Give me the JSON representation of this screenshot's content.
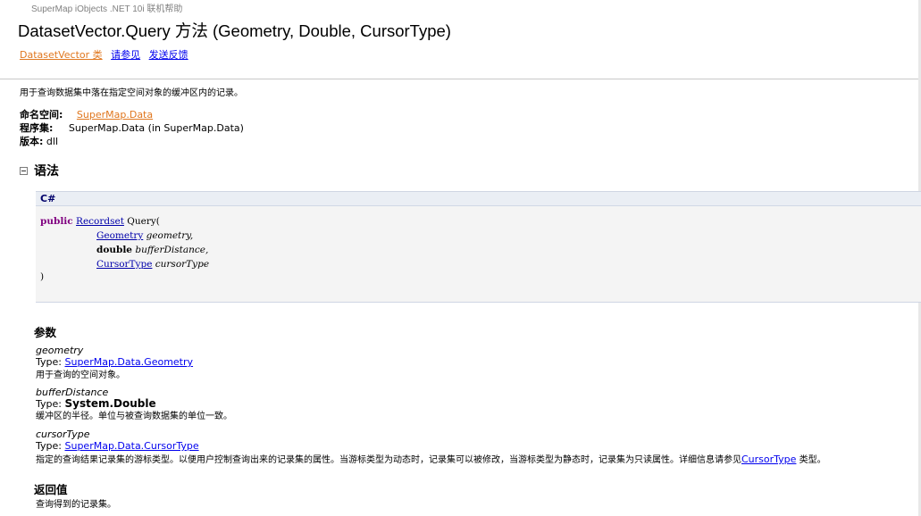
{
  "header": {
    "running_title": "SuperMap iObjects .NET 10i 联机帮助",
    "title": "DatasetVector.Query 方法  (Geometry, Double, CursorType)",
    "links": {
      "class_link": "DatasetVector 类",
      "see_also": "请参见",
      "feedback": "发送反馈"
    }
  },
  "summary": "用于查询数据集中落在指定空间对象的缓冲区内的记录。",
  "meta": {
    "namespace_label": "命名空间:",
    "namespace_value": "SuperMap.Data",
    "assembly_label": "程序集:",
    "assembly_value": "SuperMap.Data (in SuperMap.Data)",
    "version_label": "版本:",
    "version_value": "dll"
  },
  "syntax": {
    "heading": "语法",
    "language": "C#",
    "code": {
      "kw_public": "public",
      "return_type": "Recordset",
      "method": " Query(",
      "p1_type": "Geometry",
      "p1_name": "geometry,",
      "p2_type": "double",
      "p2_name": "bufferDistance,",
      "p3_type": "CursorType",
      "p3_name": "cursorType",
      "close": ")"
    }
  },
  "parameters": {
    "heading": "参数",
    "type_label": "Type:",
    "items": [
      {
        "name": "geometry",
        "type": "SuperMap.Data.Geometry",
        "desc": "用于查询的空间对象。"
      },
      {
        "name": "bufferDistance",
        "type": "System.Double",
        "desc": "缓冲区的半径。单位与被查询数据集的单位一致。"
      },
      {
        "name": "cursorType",
        "type": "SuperMap.Data.CursorType",
        "desc": "指定的查询结果记录集的游标类型。以便用户控制查询出来的记录集的属性。当游标类型为动态时，记录集可以被修改，当游标类型为静态时，记录集为只读属性。详细信息请参见",
        "desc_link": "CursorType",
        "desc_tail": " 类型。"
      }
    ]
  },
  "returns": {
    "heading": "返回值",
    "desc": "查询得到的记录集。"
  }
}
